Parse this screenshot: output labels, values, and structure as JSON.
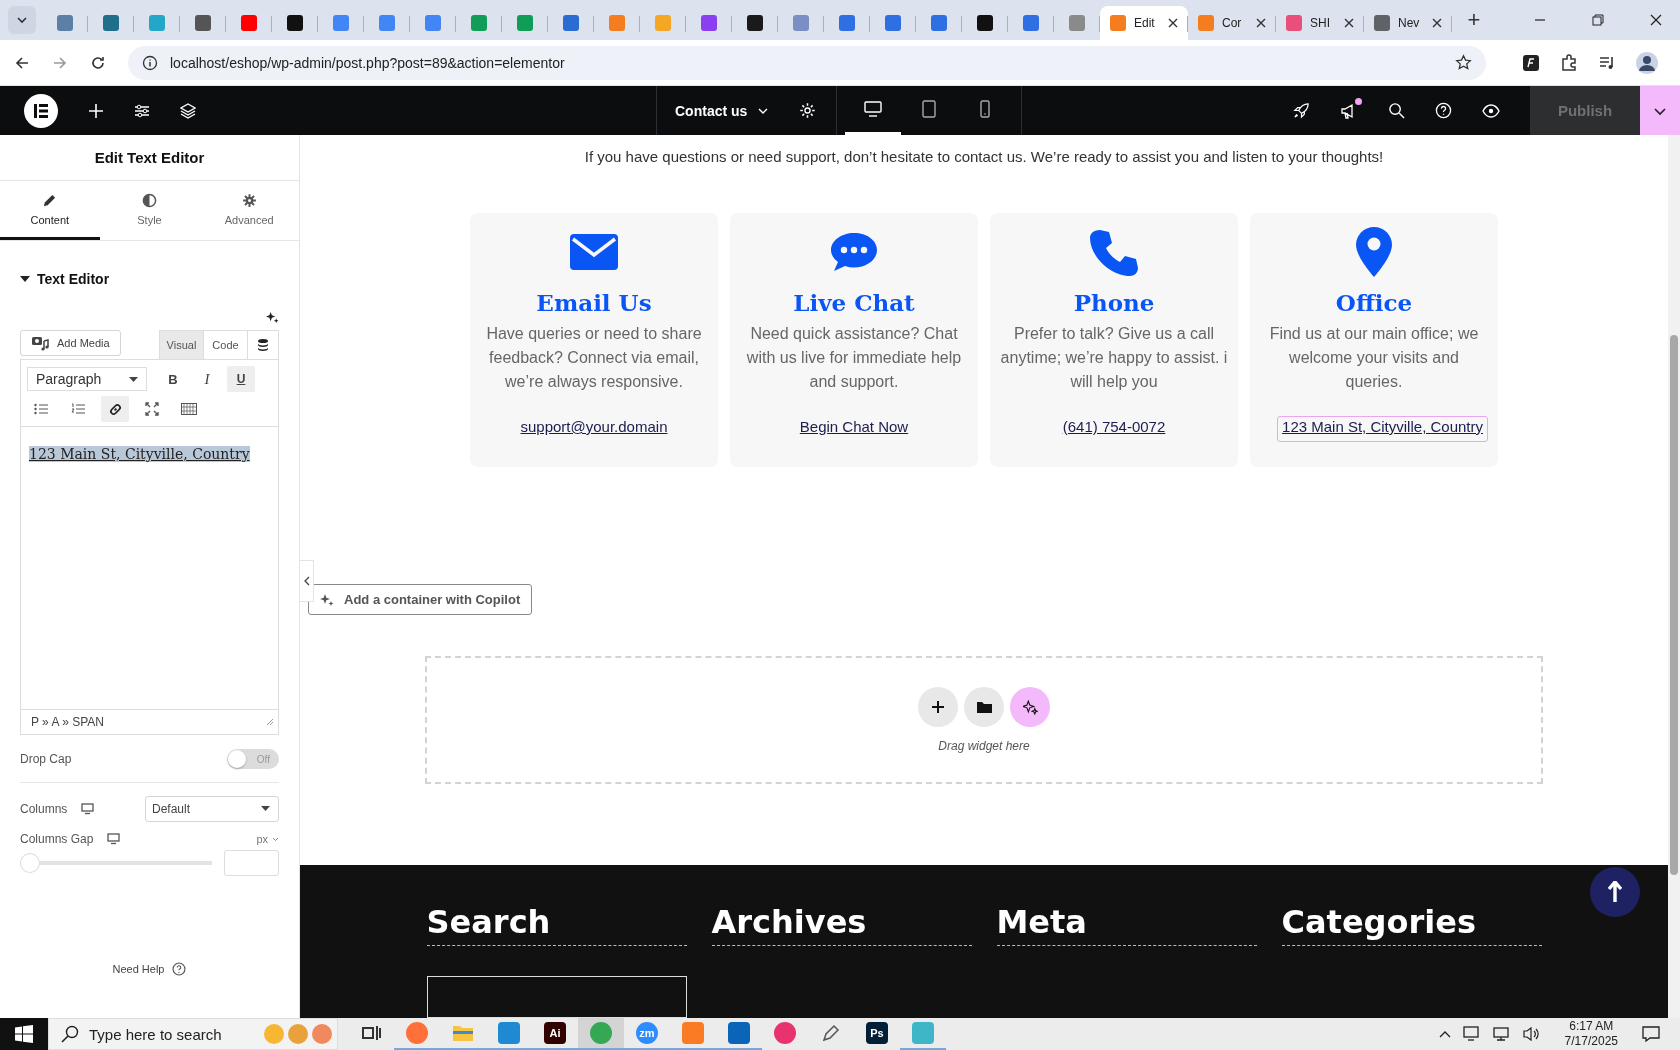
{
  "browser": {
    "tabs": [
      {
        "color": "#5b7fa6",
        "selected": false
      },
      {
        "color": "#1f6f8b",
        "selected": false
      },
      {
        "color": "#23a7c9",
        "selected": false
      },
      {
        "color": "#555555",
        "selected": false
      },
      {
        "color": "#ff0000",
        "selected": false
      },
      {
        "color": "#111111",
        "selected": false
      },
      {
        "color": "#4285f4",
        "selected": false
      },
      {
        "color": "#4285f4",
        "selected": false
      },
      {
        "color": "#4285f4",
        "selected": false
      },
      {
        "color": "#0f9d58",
        "selected": false
      },
      {
        "color": "#0f9d58",
        "selected": false
      },
      {
        "color": "#2b6cd3",
        "selected": false
      },
      {
        "color": "#f57c1f",
        "selected": false
      },
      {
        "color": "#f5a623",
        "selected": false
      },
      {
        "color": "#8a3ff0",
        "selected": false
      },
      {
        "color": "#1a1a1a",
        "selected": false
      },
      {
        "color": "#7c8fc4",
        "selected": false
      },
      {
        "color": "#2f6fe4",
        "selected": false
      },
      {
        "color": "#2f6fe4",
        "selected": false
      },
      {
        "color": "#2f6fe4",
        "selected": false
      },
      {
        "color": "#111111",
        "selected": false
      },
      {
        "color": "#2f6fe4",
        "selected": false
      },
      {
        "color": "#8a8a8a",
        "selected": false
      },
      {
        "label": "Edit",
        "color": "#f57c1f",
        "selected": true
      },
      {
        "label": "Cor",
        "color": "#f57c1f",
        "selected": false
      },
      {
        "label": "SHI",
        "color": "#e94f7a",
        "selected": false
      },
      {
        "label": "Nev",
        "color": "#5f6368",
        "selected": false
      }
    ],
    "new_tab": "+",
    "url": "localhost/eshop/wp-admin/post.php?post=89&action=elementor"
  },
  "top_bar": {
    "page": "Contact us",
    "devices": [
      {
        "kind": "desktop",
        "selected": true
      },
      {
        "kind": "tablet",
        "selected": false
      },
      {
        "kind": "mobile",
        "selected": false
      }
    ],
    "notification": true,
    "publish": {
      "label": "Publish",
      "disabled": true
    }
  },
  "panel": {
    "title": "Edit Text Editor",
    "tabs": [
      {
        "label": "Content",
        "kind": "pencil",
        "selected": true
      },
      {
        "label": "Style",
        "kind": "contrast",
        "selected": false
      },
      {
        "label": "Advanced",
        "kind": "gear",
        "selected": false
      }
    ],
    "section": {
      "title": "Text Editor",
      "expanded": true
    },
    "editor": {
      "add_media": "Add Media",
      "modes": [
        {
          "label": "Visual",
          "selected": true
        },
        {
          "label": "Code",
          "selected": false
        }
      ],
      "format": "Paragraph",
      "tools": [
        {
          "kind": "bold",
          "label": "B",
          "active": false
        },
        {
          "kind": "italic",
          "label": "I",
          "active": false
        },
        {
          "kind": "underline",
          "label": "U",
          "active": true
        },
        {
          "kind": "bullets",
          "active": false
        },
        {
          "kind": "numbers",
          "active": false
        },
        {
          "kind": "link",
          "active": true
        },
        {
          "kind": "fullscreen",
          "active": false
        },
        {
          "kind": "toolbar",
          "active": false
        }
      ],
      "content": "123 Main St, Cityville, Country",
      "path": "P » A » SPAN"
    },
    "drop_cap": {
      "label": "Drop Cap",
      "on": false,
      "state_label": "Off"
    },
    "columns": {
      "label": "Columns",
      "value": "Default"
    },
    "columns_gap": {
      "label": "Columns Gap",
      "unit": "px",
      "level": 0
    },
    "help": "Need Help"
  },
  "canvas": {
    "intro": "If you have questions or need support, don’t hesitate to contact us. We’re ready to assist you and listen to your thoughts!",
    "cards": [
      {
        "kind": "email",
        "title": "Email Us",
        "text": "Have queries or need to share feedback? Connect via email, we’re always responsive.",
        "link": "support@your.domain",
        "selected": false
      },
      {
        "kind": "chat",
        "title": "Live Chat",
        "text": "Need quick assistance? Chat with us live for immediate help and support.",
        "link": "Begin Chat Now",
        "selected": false
      },
      {
        "kind": "phone",
        "title": "Phone",
        "text": "Prefer to talk? Give us a call anytime; we’re happy to assist. i will help you",
        "link": "(641) 754-0072",
        "selected": false
      },
      {
        "kind": "location",
        "title": "Office",
        "text": "Find us at our main office; we welcome your visits and queries.",
        "link": "123 Main St, Cityville, Country",
        "selected": true
      }
    ],
    "copilot_button": "Add a container with Copilot",
    "drop_zone": {
      "hint": "Drag widget here"
    },
    "footer": {
      "widgets": [
        {
          "kind": "search",
          "title": "Search"
        },
        {
          "kind": "list",
          "title": "Archives"
        },
        {
          "kind": "list",
          "title": "Meta"
        },
        {
          "kind": "list",
          "title": "Categories"
        }
      ]
    }
  },
  "taskbar": {
    "search_placeholder": "Type here to search",
    "apps": [
      {
        "kind": "taskview",
        "color": "#333333",
        "running": false,
        "selected": false
      },
      {
        "kind": "round",
        "color": "#ff7139",
        "running": true,
        "selected": false
      },
      {
        "kind": "folder",
        "color": "#f5c542",
        "running": true,
        "selected": false
      },
      {
        "kind": "square",
        "color": "#1f8ad2",
        "running": true,
        "selected": false
      },
      {
        "kind": "square",
        "label": "Ai",
        "color": "#330000",
        "running": true,
        "selected": false
      },
      {
        "kind": "round",
        "color": "#34a853",
        "running": true,
        "selected": true
      },
      {
        "kind": "round",
        "label": "zm",
        "color": "#2d8cff",
        "running": true,
        "selected": false
      },
      {
        "kind": "square",
        "color": "#fb7a24",
        "running": true,
        "selected": false
      },
      {
        "kind": "square",
        "color": "#0a64b8",
        "running": true,
        "selected": false
      },
      {
        "kind": "round",
        "color": "#e8336e",
        "running": false,
        "selected": false
      },
      {
        "kind": "pen",
        "color": "#555555",
        "running": false,
        "selected": false
      },
      {
        "kind": "square",
        "label": "Ps",
        "color": "#001e36",
        "running": false,
        "selected": false
      },
      {
        "kind": "square",
        "color": "#3fb6c8",
        "running": true,
        "selected": false
      }
    ],
    "time": "6:17 AM",
    "date": "7/17/2025"
  }
}
